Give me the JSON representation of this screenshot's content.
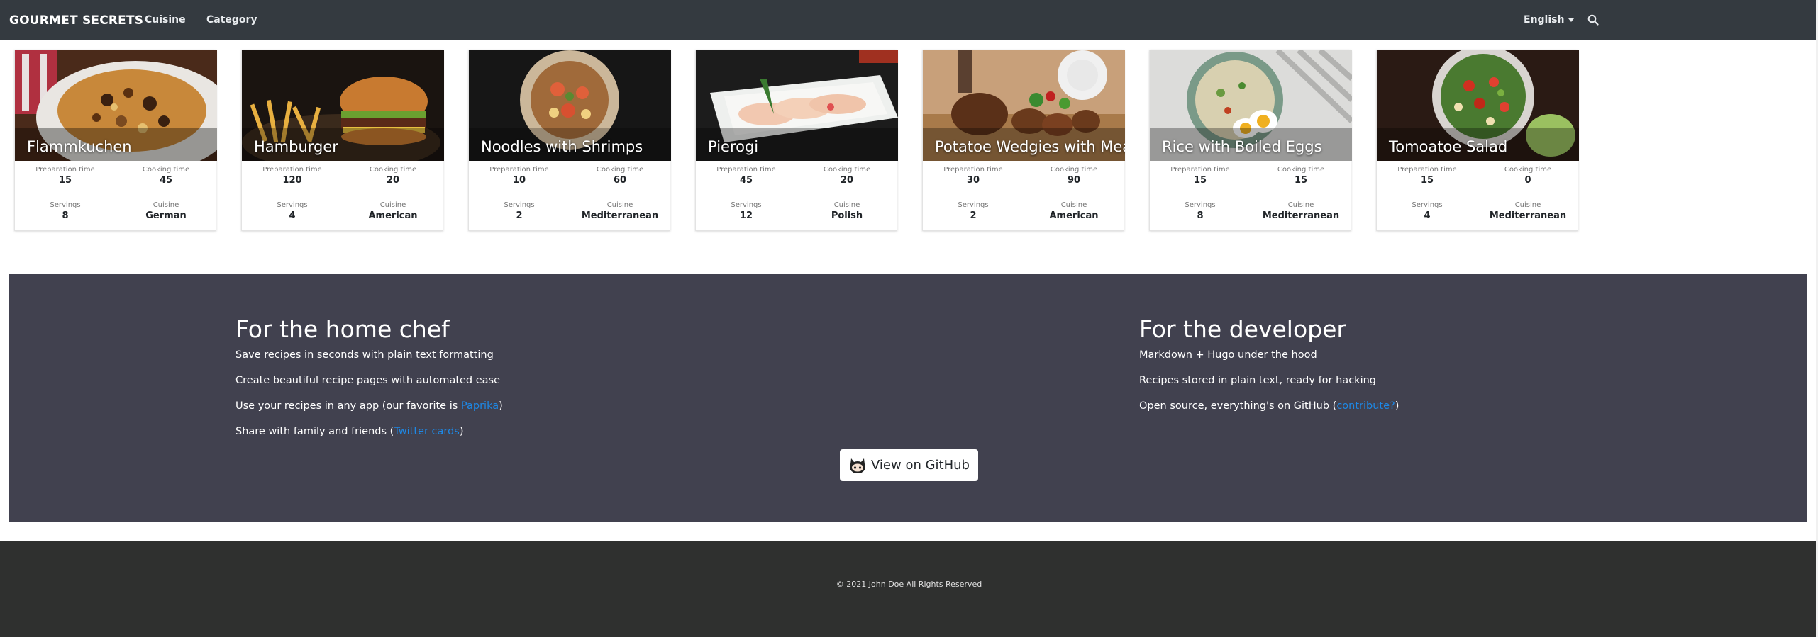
{
  "navbar": {
    "brand": "GOURMET SECRETS",
    "links": [
      "Cuisine",
      "Category"
    ],
    "language": "English",
    "search_icon": "search-icon"
  },
  "recipes": [
    {
      "title": "Flammkuchen",
      "prep_label": "Preparation time",
      "prep": "15",
      "cook_label": "Cooking time",
      "cook": "45",
      "serv_label": "Servings",
      "servings": "8",
      "cuisine_label": "Cuisine",
      "cuisine": "German"
    },
    {
      "title": "Hamburger",
      "prep_label": "Preparation time",
      "prep": "120",
      "cook_label": "Cooking time",
      "cook": "20",
      "serv_label": "Servings",
      "servings": "4",
      "cuisine_label": "Cuisine",
      "cuisine": "American"
    },
    {
      "title": "Noodles with Shrimps",
      "prep_label": "Preparation time",
      "prep": "10",
      "cook_label": "Cooking time",
      "cook": "60",
      "serv_label": "Servings",
      "servings": "2",
      "cuisine_label": "Cuisine",
      "cuisine": "Mediterranean"
    },
    {
      "title": "Pierogi",
      "prep_label": "Preparation time",
      "prep": "45",
      "cook_label": "Cooking time",
      "cook": "20",
      "serv_label": "Servings",
      "servings": "12",
      "cuisine_label": "Cuisine",
      "cuisine": "Polish"
    },
    {
      "title": "Potatoe Wedgies with Meat",
      "prep_label": "Preparation time",
      "prep": "30",
      "cook_label": "Cooking time",
      "cook": "90",
      "serv_label": "Servings",
      "servings": "2",
      "cuisine_label": "Cuisine",
      "cuisine": "American"
    },
    {
      "title": "Rice with Boiled Eggs",
      "prep_label": "Preparation time",
      "prep": "15",
      "cook_label": "Cooking time",
      "cook": "15",
      "serv_label": "Servings",
      "servings": "8",
      "cuisine_label": "Cuisine",
      "cuisine": "Mediterranean"
    },
    {
      "title": "Tomoatoe Salad",
      "prep_label": "Preparation time",
      "prep": "15",
      "cook_label": "Cooking time",
      "cook": "0",
      "serv_label": "Servings",
      "servings": "4",
      "cuisine_label": "Cuisine",
      "cuisine": "Mediterranean"
    }
  ],
  "feature": {
    "home_chef": {
      "heading": "For the home chef",
      "line1": "Save recipes in seconds with plain text formatting",
      "line2": "Create beautiful recipe pages with automated ease",
      "line3_pre": "Use your recipes in any app (our favorite is ",
      "line3_link": "Paprika",
      "line3_post": ")",
      "line4_pre": "Share with family and friends (",
      "line4_link": "Twitter cards",
      "line4_post": ")"
    },
    "developer": {
      "heading": "For the developer",
      "line1": "Markdown + Hugo under the hood",
      "line2": "Recipes stored in plain text, ready for hacking",
      "line3_pre": "Open source, everything's on GitHub (",
      "line3_link": "contribute?",
      "line3_post": ")"
    },
    "github_button": "View on GitHub"
  },
  "footer": {
    "copyright": "© 2021 John Doe All Rights Reserved"
  }
}
